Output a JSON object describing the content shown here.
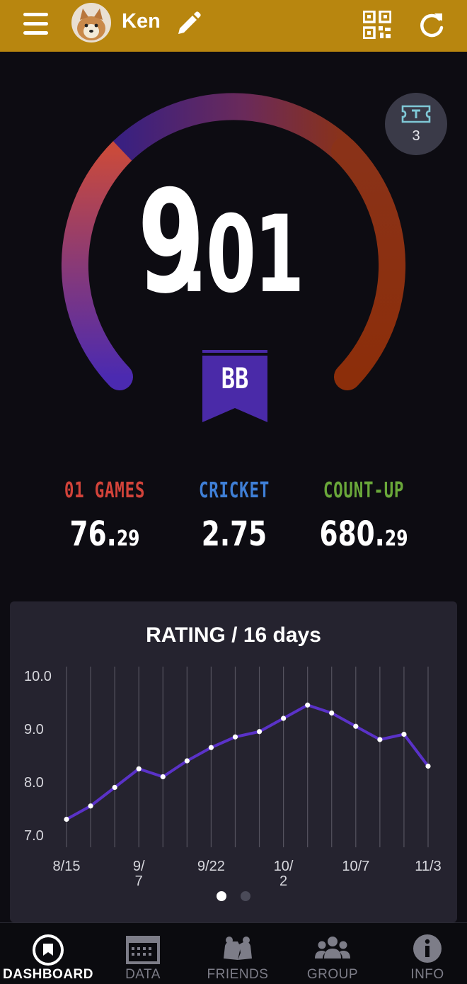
{
  "header": {
    "username": "Ken",
    "menu_icon": "hamburger-icon",
    "edit_icon": "pencil-icon",
    "qr_icon": "qr-code-icon",
    "refresh_icon": "refresh-icon",
    "background": "#b8860f"
  },
  "rating": {
    "integer": "9",
    "fraction": ".01",
    "class_badge": "BB",
    "badge_color": "#4a2aa8"
  },
  "tickets": {
    "icon": "ticket-icon",
    "count": "3"
  },
  "stats": [
    {
      "label": "01 GAMES",
      "value_main": "76.",
      "value_small": "29",
      "color": "#d2433a"
    },
    {
      "label": "CRICKET",
      "value_main": "2.75",
      "value_small": "",
      "color": "#3f7fd6"
    },
    {
      "label": "COUNT-UP",
      "value_main": "680.",
      "value_small": "29",
      "color": "#6aa83a"
    }
  ],
  "chart_title": "RATING / 16 days",
  "chart_data": {
    "type": "line",
    "x": [
      "8/15",
      "",
      "",
      "9/7",
      "",
      "",
      "9/22",
      "",
      "",
      "10/2",
      "",
      "",
      "10/7",
      "",
      "",
      "11/3"
    ],
    "x_tick_labels": [
      {
        "index": 0,
        "lines": [
          "8/15"
        ]
      },
      {
        "index": 3,
        "lines": [
          "9/",
          "7"
        ]
      },
      {
        "index": 6,
        "lines": [
          "9/22"
        ]
      },
      {
        "index": 9,
        "lines": [
          "10/",
          "2"
        ]
      },
      {
        "index": 12,
        "lines": [
          "10/7"
        ]
      },
      {
        "index": 15,
        "lines": [
          "11/3"
        ]
      }
    ],
    "series": [
      {
        "values": [
          7.3,
          7.55,
          7.9,
          8.25,
          8.1,
          8.4,
          8.65,
          8.85,
          8.95,
          9.2,
          9.45,
          9.3,
          9.05,
          8.8,
          8.9,
          8.3
        ]
      }
    ],
    "y_ticks": [
      "7.0",
      "8.0",
      "9.0",
      "10.0"
    ],
    "ylim": [
      7.0,
      10.0
    ],
    "grid": "vertical",
    "line_color": "#5a32c8"
  },
  "pager": {
    "pages": 2,
    "active": 0
  },
  "nav": [
    {
      "label": "DASHBOARD",
      "icon": "dashboard-icon",
      "active": true
    },
    {
      "label": "DATA",
      "icon": "calendar-icon",
      "active": false
    },
    {
      "label": "FRIENDS",
      "icon": "friends-icon",
      "active": false
    },
    {
      "label": "GROUP",
      "icon": "group-icon",
      "active": false
    },
    {
      "label": "INFO",
      "icon": "info-icon",
      "active": false
    }
  ]
}
